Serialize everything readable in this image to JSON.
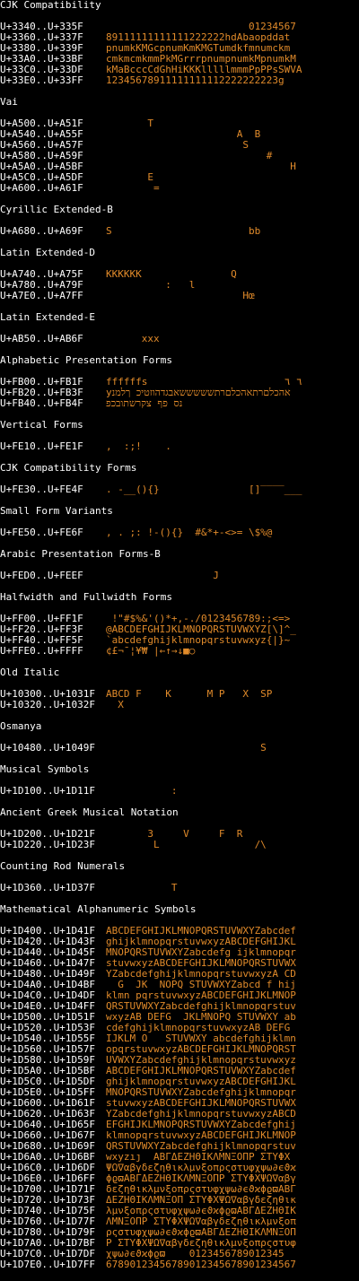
{
  "colors": {
    "background": "#000000",
    "label": "#ffffff",
    "glyph": "#e08a2a"
  },
  "sections": [
    {
      "title": "CJK Compatibility",
      "rows": [
        {
          "range": "U+3340..U+335F",
          "glyphs": "                        01234567"
        },
        {
          "range": "U+3360..U+337F",
          "glyphs": "89111111111111222222hdAbaopddat"
        },
        {
          "range": "U+3380..U+339F",
          "glyphs": "pnumkKMGcpnumKmKMGTumdkfmnumckm"
        },
        {
          "range": "U+33A0..U+33BF",
          "glyphs": "cmkmcmkmmPkMGrrrpnumpnumkMpnumkM"
        },
        {
          "range": "U+33C0..U+33DF",
          "glyphs": "kMaBcccCdGhHiKKKlllllmmmPpPPsSWVA"
        },
        {
          "range": "U+33E0..U+33FF",
          "glyphs": "12345678911111111112222222223g"
        }
      ]
    },
    {
      "title": "Vai",
      "rows": [
        {
          "range": "U+A500..U+A51F",
          "glyphs": "       T"
        },
        {
          "range": "U+A540..U+A55F",
          "glyphs": "                      A  B"
        },
        {
          "range": "U+A560..U+A57F",
          "glyphs": "                       S"
        },
        {
          "range": "U+A580..U+A59F",
          "glyphs": "                           #"
        },
        {
          "range": "U+A5A0..U+A5BF",
          "glyphs": "                               H"
        },
        {
          "range": "U+A5C0..U+A5DF",
          "glyphs": "       E"
        },
        {
          "range": "U+A600..U+A61F",
          "glyphs": "        ="
        }
      ]
    },
    {
      "title": "Cyrillic Extended-B",
      "rows": [
        {
          "range": "U+A680..U+A69F",
          "glyphs": "S                       bb"
        }
      ]
    },
    {
      "title": "Latin Extended-D",
      "rows": [
        {
          "range": "U+A740..U+A75F",
          "glyphs": "KKKKKK               Q"
        },
        {
          "range": "U+A780..U+A79F",
          "glyphs": "          :   l"
        },
        {
          "range": "U+A7E0..U+A7FF",
          "glyphs": "                       Hœ"
        }
      ]
    },
    {
      "title": "Latin Extended-E",
      "rows": [
        {
          "range": "U+AB50..U+AB6F",
          "glyphs": "      xxx"
        }
      ]
    },
    {
      "title": "Alphabetic Presentation Forms",
      "rows": [
        {
          "range": "U+FB00..U+FB1F",
          "glyphs": "ffffffs                       ٦ ٦"
        },
        {
          "range": "U+FB20..U+FB3F",
          "glyphs": "yאהכלםרתאהכלםרתשששששאבגדהוזטיכ ךלמנ"
        },
        {
          "range": "U+FB40..U+FB4F",
          "glyphs": "נס פף צקרשתובכפ"
        }
      ]
    },
    {
      "title": "Vertical Forms",
      "rows": [
        {
          "range": "U+FE10..U+FE1F",
          "glyphs": ",  :;!    ."
        }
      ]
    },
    {
      "title": "CJK Compatibility Forms",
      "rows": [
        {
          "range": "U+FE30..U+FE4F",
          "glyphs": ". -__(){}               []‾‾‾‾___"
        }
      ]
    },
    {
      "title": "Small Form Variants",
      "rows": [
        {
          "range": "U+FE50..U+FE6F",
          "glyphs": ", . ;: !-(){}  #&*+-<>= \\$%@"
        }
      ]
    },
    {
      "title": "Arabic Presentation Forms-B",
      "rows": [
        {
          "range": "U+FED0..U+FEEF",
          "glyphs": "                  J"
        }
      ]
    },
    {
      "title": "Halfwidth and Fullwidth Forms",
      "rows": [
        {
          "range": "U+FF00..U+FF1F",
          "glyphs": " !\"#$%&'()*+,-./0123456789:;<=>"
        },
        {
          "range": "U+FF20..U+FF3F",
          "glyphs": "@ABCDEFGHIJKLMNOPQRSTUVWXYZ[\\]^_"
        },
        {
          "range": "U+FF40..U+FF5F",
          "glyphs": "`abcdefghijklmnopqrstuvwxyz{|}~"
        },
        {
          "range": "U+FFE0..U+FFFF",
          "glyphs": "¢£¬¯¦¥₩ |←↑→↓■○"
        }
      ]
    },
    {
      "title": "Old Italic",
      "rows": [
        {
          "range": "U+10300..U+1031F",
          "glyphs": "ABCD F    K      M P   X  SP"
        },
        {
          "range": "U+10320..U+1032F",
          "glyphs": "  X"
        }
      ]
    },
    {
      "title": "Osmanya",
      "rows": [
        {
          "range": "U+10480..U+1049F",
          "glyphs": "                          S"
        }
      ]
    },
    {
      "title": "Musical Symbols",
      "rows": [
        {
          "range": "U+1D100..U+1D11F",
          "glyphs": "           :"
        }
      ]
    },
    {
      "title": "Ancient Greek Musical Notation",
      "rows": [
        {
          "range": "U+1D200..U+1D21F",
          "glyphs": "       3     V     F  R"
        },
        {
          "range": "U+1D220..U+1D23F",
          "glyphs": "        L                /\\"
        }
      ]
    },
    {
      "title": "Counting Rod Numerals",
      "rows": [
        {
          "range": "U+1D360..U+1D37F",
          "glyphs": "           T"
        }
      ]
    },
    {
      "title": "Mathematical Alphanumeric Symbols",
      "rows": [
        {
          "range": "U+1D400..U+1D41F",
          "glyphs": "ABCDEFGHIJKLMNOPQRSTUVWXYZabcdef"
        },
        {
          "range": "U+1D420..U+1D43F",
          "glyphs": "ghijklmnopqrstuvwxyzABCDEFGHIJKL"
        },
        {
          "range": "U+1D440..U+1D45F",
          "glyphs": "MNOPQRSTUVWXYZabcdefg ijklmnopqr"
        },
        {
          "range": "U+1D460..U+1D47F",
          "glyphs": "stuvwxyzABCDEFGHIJKLMNOPQRSTUVWX"
        },
        {
          "range": "U+1D480..U+1D49F",
          "glyphs": "YZabcdefghijklmnopqrstuvwxyzA CD"
        },
        {
          "range": "U+1D4A0..U+1D4BF",
          "glyphs": "  G  JK  NOPQ STUVWXYZabcd f hij"
        },
        {
          "range": "U+1D4C0..U+1D4DF",
          "glyphs": "klmn pqrstuvwxyzABCDEFGHIJKLMNOP"
        },
        {
          "range": "U+1D4E0..U+1D4FF",
          "glyphs": "QRSTUVWXYZabcdefghijklmnopqrstuv"
        },
        {
          "range": "U+1D500..U+1D51F",
          "glyphs": "wxyzAB DEFG  JKLMNOPQ STUVWXY ab"
        },
        {
          "range": "U+1D520..U+1D53F",
          "glyphs": "cdefghijklmnopqrstuvwxyzAB DEFG"
        },
        {
          "range": "U+1D540..U+1D55F",
          "glyphs": "IJKLM O   STUVWXY abcdefghijklmn"
        },
        {
          "range": "U+1D560..U+1D57F",
          "glyphs": "opqrstuvwxyzABCDEFGHIJKLMNOPQRST"
        },
        {
          "range": "U+1D580..U+1D59F",
          "glyphs": "UVWXYZabcdefghijklmnopqrstuvwxyz"
        },
        {
          "range": "U+1D5A0..U+1D5BF",
          "glyphs": "ABCDEFGHIJKLMNOPQRSTUVWXYZabcdef"
        },
        {
          "range": "U+1D5C0..U+1D5DF",
          "glyphs": "ghijklmnopqrstuvwxyzABCDEFGHIJKL"
        },
        {
          "range": "U+1D5E0..U+1D5FF",
          "glyphs": "MNOPQRSTUVWXYZabcdefghijklmnopqr"
        },
        {
          "range": "U+1D600..U+1D61F",
          "glyphs": "stuvwxyzABCDEFGHIJKLMNOPQRSTUVWX"
        },
        {
          "range": "U+1D620..U+1D63F",
          "glyphs": "YZabcdefghijklmnopqrstuvwxyzABCD"
        },
        {
          "range": "U+1D640..U+1D65F",
          "glyphs": "EFGHIJKLMNOPQRSTUVWXYZabcdefghij"
        },
        {
          "range": "U+1D660..U+1D67F",
          "glyphs": "klmnopqrstuvwxyzABCDEFGHIJKLMNOP"
        },
        {
          "range": "U+1D680..U+1D69F",
          "glyphs": "QRSTUVWXYZabcdefghijklmnopqrstuv"
        },
        {
          "range": "U+1D6A0..U+1D6BF",
          "glyphs": "wxyzıȷ  ΑΒΓΔΕΖΗΘΙΚΛΜΝΞΟΠΡ ΣΤΥΦΧ"
        },
        {
          "range": "U+1D6C0..U+1D6DF",
          "glyphs": "ΨΩ∇αβγδεζηθικλμνξοπρςστυφχψω∂ϵϑϰ"
        },
        {
          "range": "U+1D6E0..U+1D6FF",
          "glyphs": "ϕϱϖΑΒΓΔΕΖΗΘΙΚΛΜΝΞΟΠΡ ΣΤΥΦΧΨΩ∇αβγ"
        },
        {
          "range": "U+1D700..U+1D71F",
          "glyphs": "δεζηθικλμνξοπρςστυφχψω∂ϵϑϰϕϱϖΑΒΓ"
        },
        {
          "range": "U+1D720..U+1D73F",
          "glyphs": "ΔΕΖΗΘΙΚΛΜΝΞΟΠ ΣΤΥΦΧΨΩ∇αβγδεζηθικ"
        },
        {
          "range": "U+1D740..U+1D75F",
          "glyphs": "λμνξοπρςστυφχψω∂ϵϑϰϕϱϖΑΒΓΔΕΖΗΘΙΚ"
        },
        {
          "range": "U+1D760..U+1D77F",
          "glyphs": "ΛΜΝΞΟΠΡ ΣΤΥΦΧΨΩ∇αβγδεζηθικλμνξοπ"
        },
        {
          "range": "U+1D780..U+1D79F",
          "glyphs": "ρςστυφχψω∂ϵϑϰϕϱϖΑΒΓΔΕΖΗΘΙΚΛΜΝΞΟΠ"
        },
        {
          "range": "U+1D7A0..U+1D7BF",
          "glyphs": "Ρ ΣΤΥΦΧΨΩ∇αβγδεζηθικλμνξοπρςστυφ"
        },
        {
          "range": "U+1D7C0..U+1D7DF",
          "glyphs": "χψω∂ϵϑϰϕϱϖ    0123456789012345"
        },
        {
          "range": "U+1D7E0..U+1D7FF",
          "glyphs": "67890123456789012345678901234567"
        }
      ]
    }
  ]
}
